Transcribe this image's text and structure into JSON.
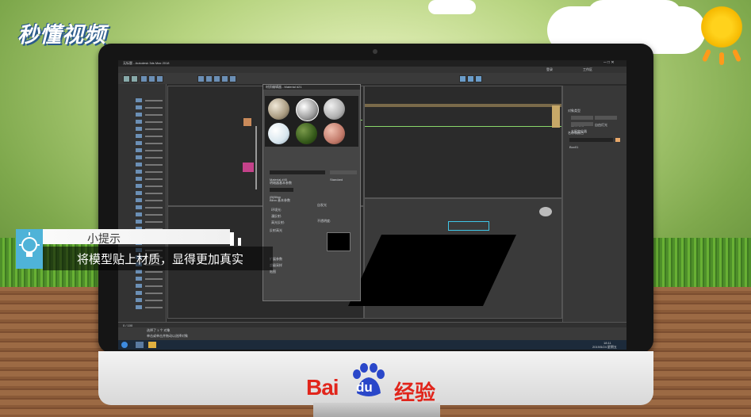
{
  "overlay": {
    "logo_text": "秒懂视频",
    "tip_title": "小提示",
    "tip_body": "将模型贴上材质，显得更加真实",
    "bottom_brand": "Bai",
    "bottom_brand_du": "du",
    "bottom_brand_suffix": "经验"
  },
  "app": {
    "window_title": "无标题 - Autodesk 3ds Max 2018",
    "workspace": "工作区",
    "search_placeholder": "登录",
    "status_line1": "选择了 1 个 对象",
    "status_line2": "单击或单击并拖动以选择对象",
    "frame_counter": "0 / 100",
    "material_editor_title": "材质编辑器 - Material #21",
    "material_slot_name": "Material #40",
    "material_type": "Standard",
    "shader_rollout": "明暗器基本参数",
    "shader_type": "(B)Blinn",
    "blinn_rollout": "Blinn 基本参数",
    "self_illum": "自发光",
    "ambient_label": "环境光:",
    "diffuse_label": "漫反射:",
    "specular_label": "高光反射:",
    "opacity_label": "不透明度:",
    "specular_highlights": "反射高光",
    "extended_rollout": "扩展参数",
    "supersampling_rollout": "超级采样",
    "maps_rollout": "贴图",
    "create_panel_object_type": "对象类型",
    "create_panel_name": "名称和颜色",
    "create_btn1": "目标灯光",
    "create_btn2": "自由灯光",
    "create_btn3": "太阳定位器",
    "name_field": "Box01",
    "clock_time": "18:11",
    "clock_date": "2019/5/24 星期五"
  },
  "colors": {
    "accent_blue": "#4fb3d8",
    "baidu_red": "#e1251b",
    "baidu_blue": "#2a47c9"
  }
}
